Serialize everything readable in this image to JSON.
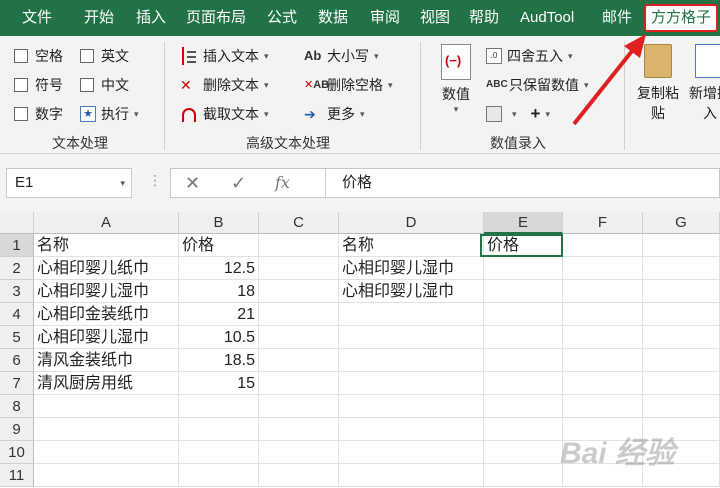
{
  "menu": {
    "tabs": [
      "文件",
      "开始",
      "插入",
      "页面布局",
      "公式",
      "数据",
      "审阅",
      "视图",
      "帮助",
      "AudTool",
      "邮件",
      "方方格子"
    ]
  },
  "ribbon": {
    "text_group": {
      "checks": [
        "空格",
        "英文",
        "符号",
        "中文",
        "数字"
      ],
      "exec": "执行",
      "label": "文本处理"
    },
    "adv_group": {
      "insert": "插入文本",
      "delete": "删除文本",
      "cut": "截取文本",
      "case": "大小写",
      "delspace": "删除空格",
      "more": "更多",
      "label": "高级文本处理"
    },
    "num_group": {
      "value": "数值",
      "round": "四舍五入",
      "keep": "只保留数值",
      "plus": "+",
      "label": "数值录入"
    },
    "paste": "复制粘贴",
    "newadd": "新增插入"
  },
  "formula": {
    "namebox": "E1",
    "x": "✕",
    "check": "✓",
    "fx": "fx",
    "value": "价格"
  },
  "grid": {
    "columns": [
      "A",
      "B",
      "C",
      "D",
      "E",
      "F",
      "G"
    ],
    "rows": [
      "1",
      "2",
      "3",
      "4",
      "5",
      "6",
      "7",
      "8",
      "9",
      "10",
      "11"
    ],
    "A": [
      "名称",
      "心相印婴儿纸巾",
      "心相印婴儿湿巾",
      "心相印金装纸巾",
      "心相印婴儿湿巾",
      "清风金装纸巾",
      "清风厨房用纸"
    ],
    "B": [
      "价格",
      "12.5",
      "18",
      "21",
      "10.5",
      "18.5",
      "15"
    ],
    "D": [
      "名称",
      "心相印婴儿湿巾",
      "心相印婴儿湿巾"
    ],
    "E": [
      "价格"
    ]
  },
  "watermark": "Bai 经验"
}
